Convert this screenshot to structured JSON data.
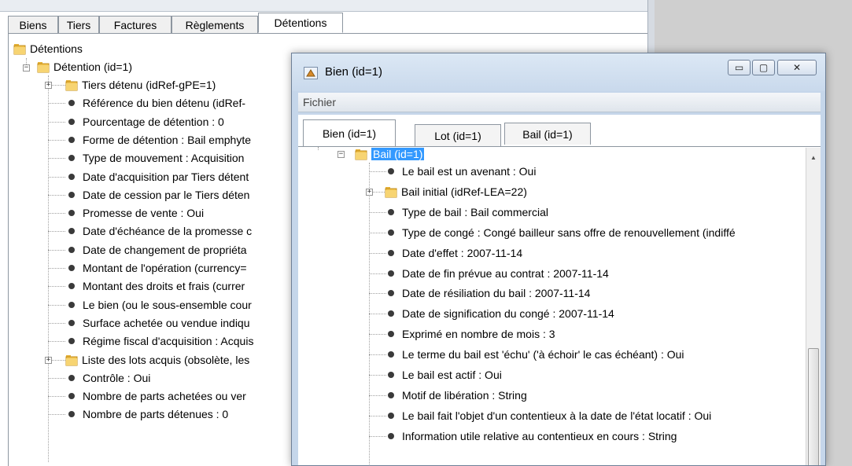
{
  "main_tabs": [
    {
      "label": "Biens"
    },
    {
      "label": "Tiers"
    },
    {
      "label": "Factures"
    },
    {
      "label": "Règlements"
    },
    {
      "label": "Détentions"
    }
  ],
  "left_tree": {
    "root": "Détentions",
    "node": "Détention (id=1)",
    "items": [
      {
        "label": "Tiers détenu (idRef-gPE=1)",
        "kind": "folder"
      },
      {
        "label": "Référence du bien détenu (idRef-",
        "kind": "leaf"
      },
      {
        "label": "Pourcentage de détention : 0",
        "kind": "leaf"
      },
      {
        "label": "Forme de détention : Bail emphyte",
        "kind": "leaf"
      },
      {
        "label": "Type de mouvement : Acquisition",
        "kind": "leaf"
      },
      {
        "label": "Date d'acquisition par Tiers détent",
        "kind": "leaf"
      },
      {
        "label": "Date de cession par le Tiers déten",
        "kind": "leaf"
      },
      {
        "label": "Promesse de vente : Oui",
        "kind": "leaf"
      },
      {
        "label": "Date d'échéance de la promesse c",
        "kind": "leaf"
      },
      {
        "label": "Date de changement de propriéta",
        "kind": "leaf"
      },
      {
        "label": "Montant de l'opération (currency=",
        "kind": "leaf"
      },
      {
        "label": "Montant des droits et frais (currer",
        "kind": "leaf"
      },
      {
        "label": "Le bien (ou le sous-ensemble cour",
        "kind": "leaf"
      },
      {
        "label": "Surface achetée ou vendue indiqu",
        "kind": "leaf"
      },
      {
        "label": "Régime fiscal d'acquisition : Acquis",
        "kind": "leaf"
      },
      {
        "label": "Liste des lots acquis (obsolète, les",
        "kind": "folder"
      },
      {
        "label": "Contrôle : Oui",
        "kind": "leaf"
      },
      {
        "label": "Nombre de parts achetées ou ver",
        "kind": "leaf"
      },
      {
        "label": "Nombre de parts détenues : 0",
        "kind": "leaf"
      }
    ]
  },
  "dialog": {
    "title": "Bien (id=1)",
    "minimize": "▭",
    "maximize": "▢",
    "close": "✕",
    "menu": "Fichier",
    "tabs": [
      {
        "label": "Bien (id=1)"
      },
      {
        "label": "Lot (id=1)"
      },
      {
        "label": "Bail (id=1)"
      }
    ],
    "tree": {
      "node": "Bail (id=1)",
      "items": [
        {
          "label": "Le bail est un avenant : Oui",
          "kind": "leaf"
        },
        {
          "label": "Bail initial (idRef-LEA=22)",
          "kind": "folder"
        },
        {
          "label": "Type de bail : Bail commercial",
          "kind": "leaf"
        },
        {
          "label": "Type de congé : Congé bailleur sans offre de renouvellement (indiffé",
          "kind": "leaf"
        },
        {
          "label": "Date d'effet : 2007-11-14",
          "kind": "leaf"
        },
        {
          "label": "Date de fin prévue au contrat : 2007-11-14",
          "kind": "leaf"
        },
        {
          "label": "Date de résiliation du bail : 2007-11-14",
          "kind": "leaf"
        },
        {
          "label": "Date de signification du congé : 2007-11-14",
          "kind": "leaf"
        },
        {
          "label": "Exprimé en nombre de mois : 3",
          "kind": "leaf"
        },
        {
          "label": "Le terme du bail est 'échu' ('à échoir' le cas échéant) : Oui",
          "kind": "leaf"
        },
        {
          "label": "Le bail est actif : Oui",
          "kind": "leaf"
        },
        {
          "label": "Motif de libération : String",
          "kind": "leaf"
        },
        {
          "label": "Le bail fait l'objet d'un contentieux à la date de l'état locatif : Oui",
          "kind": "leaf"
        },
        {
          "label": "Information utile relative au contentieux en cours : String",
          "kind": "leaf"
        }
      ]
    }
  }
}
